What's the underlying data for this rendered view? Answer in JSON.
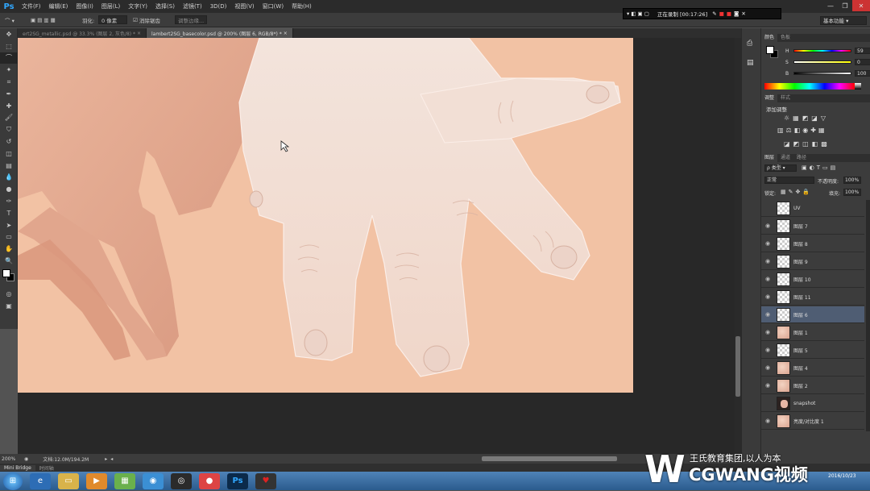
{
  "app": {
    "logo": "Ps"
  },
  "menu": [
    "文件(F)",
    "编辑(E)",
    "图像(I)",
    "图层(L)",
    "文字(Y)",
    "选择(S)",
    "滤镜(T)",
    "3D(D)",
    "视图(V)",
    "窗口(W)",
    "帮助(H)"
  ],
  "options": {
    "feather_label": "羽化:",
    "feather_value": "0 像素",
    "antialias_label": "消除锯齿",
    "refine_edge": "调整边缘..."
  },
  "recording": {
    "status": "正在录制 [00:17:26]"
  },
  "workspace": {
    "label": "基本功能"
  },
  "tabs": [
    {
      "label": "ert2SG_metallic.psd @ 33.3% (图层 2, 灰色/8) *"
    },
    {
      "label": "lambert2SG_basecolor.psd @ 200% (图层 6, RGB/8*) *"
    }
  ],
  "status": {
    "zoom": "200%",
    "doc": "文档:12.0M/194.2M"
  },
  "bottom_tabs": [
    "Mini Bridge",
    "时间轴"
  ],
  "color_panel": {
    "tabs": [
      "颜色",
      "色板"
    ],
    "labels": [
      "H",
      "S",
      "B"
    ],
    "values": [
      "59",
      "0",
      "100"
    ],
    "unit_deg": "°",
    "unit_pct": "%"
  },
  "adjust_panel": {
    "tabs": [
      "调整",
      "样式"
    ],
    "title": "添加调整"
  },
  "layers_panel": {
    "tabs": [
      "图层",
      "通道",
      "路径"
    ],
    "filter_label": "ρ 类型",
    "blend_mode": "正常",
    "opacity_label": "不透明度:",
    "opacity_value": "100%",
    "lock_label": "锁定:",
    "fill_label": "填充:",
    "fill_value": "100%",
    "layers": [
      {
        "name": "UV",
        "visible": false,
        "thumb": "checker"
      },
      {
        "name": "图层 7",
        "visible": true,
        "thumb": "checker"
      },
      {
        "name": "图层 8",
        "visible": true,
        "thumb": "checker"
      },
      {
        "name": "图层 9",
        "visible": true,
        "thumb": "checker"
      },
      {
        "name": "图层 10",
        "visible": true,
        "thumb": "checker"
      },
      {
        "name": "图层 11",
        "visible": true,
        "thumb": "checker"
      },
      {
        "name": "图层 6",
        "visible": true,
        "thumb": "checker",
        "selected": true
      },
      {
        "name": "图层 1",
        "visible": true,
        "thumb": "skin"
      },
      {
        "name": "图层 5",
        "visible": true,
        "thumb": "checker"
      },
      {
        "name": "图层 4",
        "visible": true,
        "thumb": "skin"
      },
      {
        "name": "图层 2",
        "visible": true,
        "thumb": "skin"
      },
      {
        "name": "snapshot",
        "visible": false,
        "thumb": "snap"
      },
      {
        "name": "亮度/对比度 1",
        "visible": true,
        "thumb": "skin"
      }
    ]
  },
  "watermark": {
    "tagline": "王氏教育集团,以人为本",
    "brand": "CGWANG视频"
  },
  "clock": {
    "date": "2016/10/23"
  },
  "colors": {
    "canvas_bg": "#f2c2a4",
    "skin_dark": "#df9f85",
    "skin_light": "#f2ddd3",
    "selection": "#4f5d73"
  }
}
